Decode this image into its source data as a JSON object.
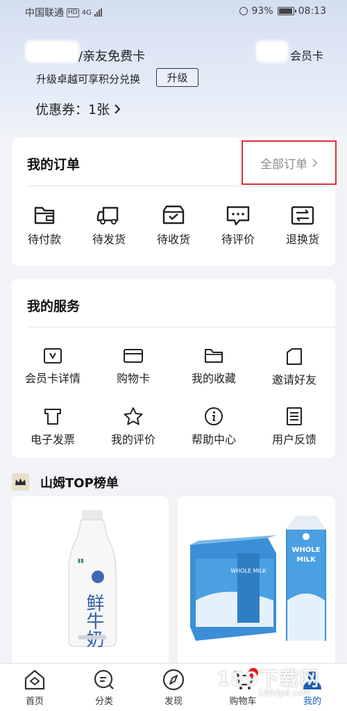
{
  "status_bar": {
    "carrier": "中国联通",
    "network_badge": "HD",
    "network_type": "4G",
    "battery": "93%",
    "battery_level": 0.93,
    "time": "08:13"
  },
  "member": {
    "card_name": "/亲友免费卡",
    "card_type": "会员卡",
    "upgrade_hint": "升级卓越可享积分兑换",
    "upgrade_button": "升级",
    "coupon": "优惠券：1张"
  },
  "orders": {
    "title": "我的订单",
    "all_orders": "全部订单",
    "items": [
      {
        "label": "待付款",
        "icon": "wallet-icon"
      },
      {
        "label": "待发货",
        "icon": "truck-icon"
      },
      {
        "label": "待收货",
        "icon": "package-icon"
      },
      {
        "label": "待评价",
        "icon": "comment-icon"
      },
      {
        "label": "退换货",
        "icon": "exchange-icon"
      }
    ]
  },
  "services": {
    "title": "我的服务",
    "items": [
      {
        "label": "会员卡详情",
        "icon": "member-card-icon"
      },
      {
        "label": "购物卡",
        "icon": "credit-card-icon"
      },
      {
        "label": "我的收藏",
        "icon": "folder-icon"
      },
      {
        "label": "邀请好友",
        "icon": "invite-icon"
      },
      {
        "label": "电子发票",
        "icon": "invoice-icon"
      },
      {
        "label": "我的评价",
        "icon": "star-icon"
      },
      {
        "label": "帮助中心",
        "icon": "info-icon"
      },
      {
        "label": "用户反馈",
        "icon": "document-icon"
      }
    ]
  },
  "top_list": {
    "title": "山姆TOP榜单",
    "products": [
      {
        "label": "鲜牛奶"
      },
      {
        "label": "WHOLE MILK"
      }
    ]
  },
  "bottom_nav": {
    "items": [
      {
        "label": "首页",
        "icon": "home-icon"
      },
      {
        "label": "分类",
        "icon": "category-icon"
      },
      {
        "label": "发现",
        "icon": "compass-icon"
      },
      {
        "label": "购物车",
        "icon": "cart-icon"
      },
      {
        "label": "我的",
        "icon": "profile-icon"
      }
    ]
  },
  "watermark": {
    "text": "189下载网",
    "sub": "189dpd.com"
  },
  "colors": {
    "accent": "#1f5fb8",
    "highlight": "#d8333a",
    "badge": "#e02020"
  }
}
